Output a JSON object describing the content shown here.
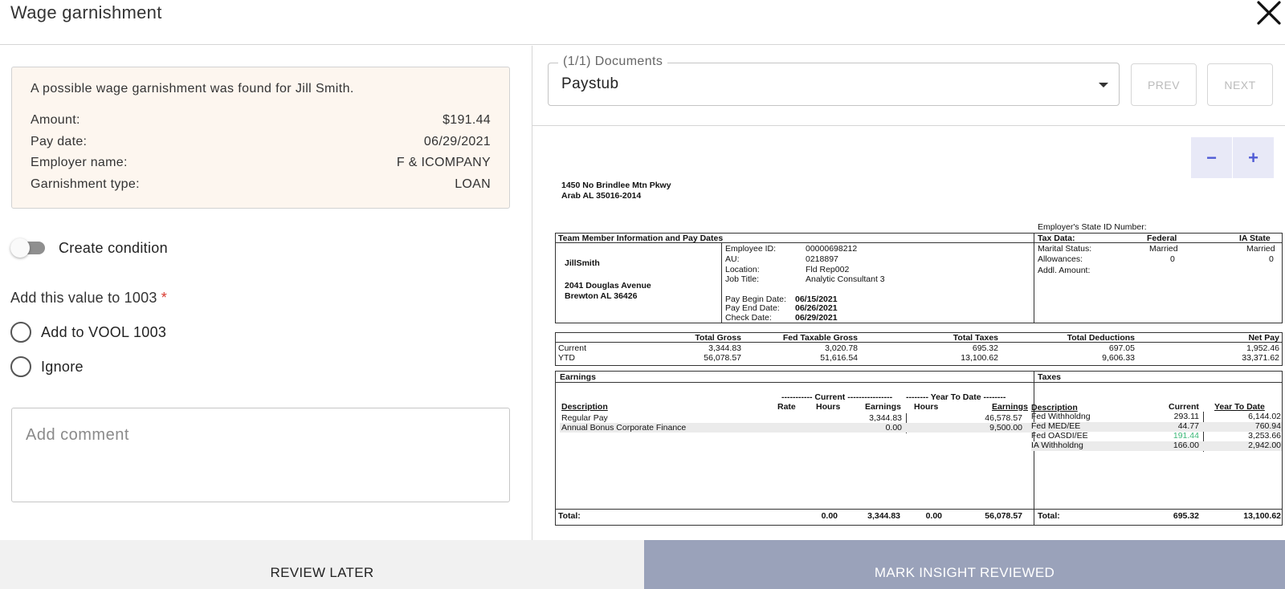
{
  "header": {
    "title": "Wage garnishment",
    "close_icon": "close-icon"
  },
  "alert": {
    "message": "A possible wage garnishment was found for Jill Smith.",
    "rows": [
      {
        "label": "Amount:",
        "value": "$191.44"
      },
      {
        "label": "Pay date:",
        "value": "06/29/2021"
      },
      {
        "label": "Employer name:",
        "value": "F & ICOMPANY"
      },
      {
        "label": "Garnishment type:",
        "value": "LOAN"
      }
    ]
  },
  "toggle": {
    "label": "Create condition",
    "on": false
  },
  "question": {
    "label": "Add this value to 1003",
    "required_mark": "*"
  },
  "options": [
    {
      "label": "Add to VOOL 1003"
    },
    {
      "label": "Ignore"
    }
  ],
  "comment": {
    "placeholder": "Add comment",
    "value": ""
  },
  "documents": {
    "legend": "(1/1) Documents",
    "selected": "Paystub",
    "prev_label": "PREV",
    "next_label": "NEXT"
  },
  "zoom": {
    "out_label": "−",
    "in_label": "+"
  },
  "paystub": {
    "addr_line1": "1450 No Brindlee Mtn Pkwy",
    "addr_line2": "Arab AL 35016-2014",
    "state_id_label": "Employer's State ID Number:",
    "team_header": "Team Member Information and Pay Dates",
    "employee_name": "JillSmith",
    "employee_addr1": "2041 Douglas Avenue",
    "employee_addr2": "Brewton AL 36426",
    "info_labels": [
      "Employee ID:",
      "AU:",
      "Location:",
      "Job Title:"
    ],
    "info_values": [
      "00000698212",
      "0218897",
      "Fld Rep002",
      "Analytic Consultant 3"
    ],
    "date_labels": [
      "Pay Begin Date:",
      "Pay End Date:",
      "Check Date:"
    ],
    "date_values": [
      "06/15/2021",
      "06/26/2021",
      "06/29/2021"
    ],
    "tax_data": {
      "header": "Tax Data:",
      "federal": "Federal",
      "state": "IA State",
      "marital_label": "Marital Status:",
      "marital_fed": "Married",
      "marital_state": "Married",
      "allow_label": "Allowances:",
      "allow_fed": "0",
      "allow_state": "0",
      "addl_label": "Addl. Amount:"
    },
    "summary": {
      "headers": [
        "Total Gross",
        "Fed Taxable Gross",
        "Total Taxes",
        "Total Deductions",
        "Net Pay"
      ],
      "rows": [
        {
          "label": "Current",
          "values": [
            "3,344.83",
            "3,020.78",
            "695.32",
            "697.05",
            "1,952.46"
          ]
        },
        {
          "label": "YTD",
          "values": [
            "56,078.57",
            "51,616.54",
            "13,100.62",
            "9,606.33",
            "33,371.62"
          ]
        }
      ]
    },
    "earnings": {
      "title": "Earnings",
      "current_group": "----------- Current ----------------",
      "ytd_group": "-------- Year To Date --------",
      "col_desc": "Description",
      "col_rate": "Rate",
      "col_hours": "Hours",
      "col_earnings": "Earnings",
      "col_ytd_hours": "Hours",
      "col_ytd_earnings": "Earnings",
      "rows": [
        {
          "desc": "Regular Pay",
          "earnings": "3,344.83",
          "ytd": "46,578.57"
        },
        {
          "desc": "Annual Bonus Corporate Finance",
          "earnings": "0.00",
          "ytd": "9,500.00"
        }
      ],
      "total_label": "Total:",
      "total_hours": "0.00",
      "total_earnings": "3,344.83",
      "total_ytd_hours": "0.00",
      "total_ytd_earnings": "56,078.57"
    },
    "taxes": {
      "title": "Taxes",
      "col_desc": "Description",
      "col_current": "Current",
      "col_ytd": "Year To Date",
      "rows": [
        {
          "desc": "Fed Withholdng",
          "current": "293.11",
          "ytd": "6,144.02"
        },
        {
          "desc": "Fed MED/EE",
          "current": "44.77",
          "ytd": "760.94"
        },
        {
          "desc": "Fed OASDI/EE",
          "current": "191.44",
          "ytd": "3,253.66"
        },
        {
          "desc": "IA Withholdng",
          "current": "166.00",
          "ytd": "2,942.00"
        }
      ],
      "highlight_color": "#3cb878",
      "total_label": "Total:",
      "total_current": "695.32",
      "total_ytd": "13,100.62"
    }
  },
  "footer": {
    "later_label": "REVIEW LATER",
    "reviewed_label": "MARK INSIGHT REVIEWED"
  }
}
